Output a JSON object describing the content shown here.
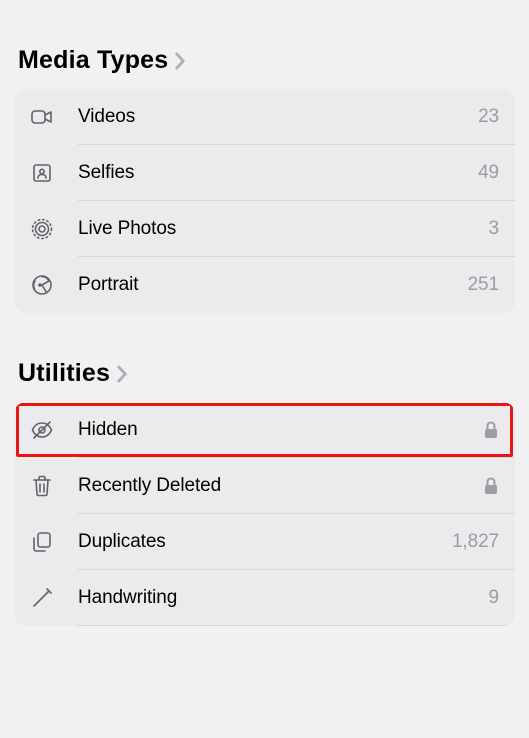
{
  "sections": {
    "media_types": {
      "title": "Media Types",
      "items": [
        {
          "key": "videos",
          "label": "Videos",
          "count": "23",
          "icon": "video"
        },
        {
          "key": "selfies",
          "label": "Selfies",
          "count": "49",
          "icon": "selfie"
        },
        {
          "key": "live_photos",
          "label": "Live Photos",
          "count": "3",
          "icon": "live"
        },
        {
          "key": "portrait",
          "label": "Portrait",
          "count": "251",
          "icon": "aperture"
        }
      ]
    },
    "utilities": {
      "title": "Utilities",
      "items": [
        {
          "key": "hidden",
          "label": "Hidden",
          "icon": "eye-slash",
          "locked": true
        },
        {
          "key": "recently_deleted",
          "label": "Recently Deleted",
          "icon": "trash",
          "locked": true
        },
        {
          "key": "duplicates",
          "label": "Duplicates",
          "count": "1,827",
          "icon": "duplicate"
        },
        {
          "key": "handwriting",
          "label": "Handwriting",
          "count": "9",
          "icon": "pencil"
        }
      ]
    }
  },
  "highlight": {
    "target": "hidden"
  }
}
